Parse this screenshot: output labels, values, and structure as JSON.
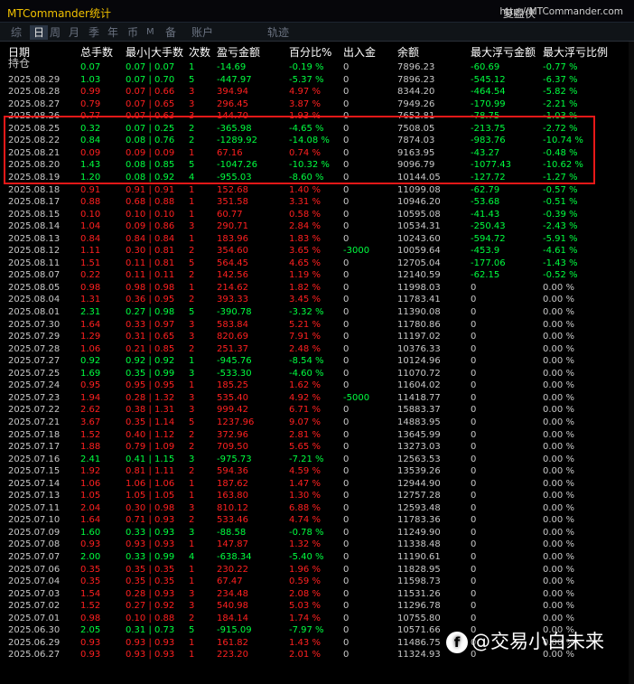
{
  "titlebar": {
    "title": "MTCommander统计",
    "replay": "复盘侠",
    "url": "http://MTCommander.com"
  },
  "tabs": [
    {
      "label": "综",
      "active": false
    },
    {
      "label": "日",
      "active": true
    },
    {
      "label": "周",
      "active": false
    },
    {
      "label": "月",
      "active": false
    },
    {
      "label": "季",
      "active": false
    },
    {
      "label": "年",
      "active": false
    },
    {
      "label": "币",
      "active": false
    },
    {
      "label": "M",
      "active": false
    },
    {
      "label": "备",
      "active": false
    },
    {
      "label": "账户",
      "active": false
    },
    {
      "label": "轨迹",
      "active": false
    }
  ],
  "table": {
    "headers": [
      "日期",
      "总手数",
      "最小|大手数",
      "次数",
      "盈亏金额",
      "百分比%",
      "出入金",
      "余额",
      "最大浮亏金额",
      "最大浮亏比例"
    ],
    "holding_label": "持仓",
    "holding": [
      "",
      "0.07",
      "0.07 | 0.07",
      "1",
      "-14.69",
      "-0.19 %",
      "0",
      "7896.23",
      "-60.69",
      "-0.77 %"
    ],
    "rows": [
      [
        "2025.08.29",
        "1.03",
        "0.07 | 0.70",
        "5",
        "-447.97",
        "-5.37 %",
        "0",
        "7896.23",
        "-545.12",
        "-6.37 %"
      ],
      [
        "2025.08.28",
        "0.99",
        "0.07 | 0.66",
        "3",
        "394.94",
        "4.97 %",
        "0",
        "8344.20",
        "-464.54",
        "-5.82 %"
      ],
      [
        "2025.08.27",
        "0.79",
        "0.07 | 0.65",
        "3",
        "296.45",
        "3.87 %",
        "0",
        "7949.26",
        "-170.99",
        "-2.21 %"
      ],
      [
        "2025.08.26",
        "0.77",
        "0.07 | 0.63",
        "3",
        "144.70",
        "1.93 %",
        "0",
        "7652.81",
        "-78.75",
        "-1.03 %"
      ],
      [
        "2025.08.25",
        "0.32",
        "0.07 | 0.25",
        "2",
        "-365.98",
        "-4.65 %",
        "0",
        "7508.05",
        "-213.75",
        "-2.72 %"
      ],
      [
        "2025.08.22",
        "0.84",
        "0.08 | 0.76",
        "2",
        "-1289.92",
        "-14.08 %",
        "0",
        "7874.03",
        "-983.76",
        "-10.74 %"
      ],
      [
        "2025.08.21",
        "0.09",
        "0.09 | 0.09",
        "1",
        "67.16",
        "0.74 %",
        "0",
        "9163.95",
        "-43.27",
        "-0.48 %"
      ],
      [
        "2025.08.20",
        "1.43",
        "0.08 | 0.85",
        "5",
        "-1047.26",
        "-10.32 %",
        "0",
        "9096.79",
        "-1077.43",
        "-10.62 %"
      ],
      [
        "2025.08.19",
        "1.20",
        "0.08 | 0.92",
        "4",
        "-955.03",
        "-8.60 %",
        "0",
        "10144.05",
        "-127.72",
        "-1.27 %"
      ],
      [
        "2025.08.18",
        "0.91",
        "0.91 | 0.91",
        "1",
        "152.68",
        "1.40 %",
        "0",
        "11099.08",
        "-62.79",
        "-0.57 %"
      ],
      [
        "2025.08.17",
        "0.88",
        "0.68 | 0.88",
        "1",
        "351.58",
        "3.31 %",
        "0",
        "10946.20",
        "-53.68",
        "-0.51 %"
      ],
      [
        "2025.08.15",
        "0.10",
        "0.10 | 0.10",
        "1",
        "60.77",
        "0.58 %",
        "0",
        "10595.08",
        "-41.43",
        "-0.39 %"
      ],
      [
        "2025.08.14",
        "1.04",
        "0.09 | 0.86",
        "3",
        "290.71",
        "2.84 %",
        "0",
        "10534.31",
        "-250.43",
        "-2.43 %"
      ],
      [
        "2025.08.13",
        "0.84",
        "0.84 | 0.84",
        "1",
        "183.96",
        "1.83 %",
        "0",
        "10243.60",
        "-594.72",
        "-5.91 %"
      ],
      [
        "2025.08.12",
        "1.11",
        "0.30 | 0.81",
        "2",
        "354.60",
        "3.65 %",
        "-3000",
        "10059.64",
        "-453.9",
        "-4.61 %"
      ],
      [
        "2025.08.11",
        "1.51",
        "0.11 | 0.81",
        "5",
        "564.45",
        "4.65 %",
        "0",
        "12705.04",
        "-177.06",
        "-1.43 %"
      ],
      [
        "2025.08.07",
        "0.22",
        "0.11 | 0.11",
        "2",
        "142.56",
        "1.19 %",
        "0",
        "12140.59",
        "-62.15",
        "-0.52 %"
      ],
      [
        "2025.08.05",
        "0.98",
        "0.98 | 0.98",
        "1",
        "214.62",
        "1.82 %",
        "0",
        "11998.03",
        "0",
        "0.00 %"
      ],
      [
        "2025.08.04",
        "1.31",
        "0.36 | 0.95",
        "2",
        "393.33",
        "3.45 %",
        "0",
        "11783.41",
        "0",
        "0.00 %"
      ],
      [
        "2025.08.01",
        "2.31",
        "0.27 | 0.98",
        "5",
        "-390.78",
        "-3.32 %",
        "0",
        "11390.08",
        "0",
        "0.00 %"
      ],
      [
        "2025.07.30",
        "1.64",
        "0.33 | 0.97",
        "3",
        "583.84",
        "5.21 %",
        "0",
        "11780.86",
        "0",
        "0.00 %"
      ],
      [
        "2025.07.29",
        "1.29",
        "0.31 | 0.65",
        "3",
        "820.69",
        "7.91 %",
        "0",
        "11197.02",
        "0",
        "0.00 %"
      ],
      [
        "2025.07.28",
        "1.06",
        "0.21 | 0.85",
        "2",
        "251.37",
        "2.48 %",
        "0",
        "10376.33",
        "0",
        "0.00 %"
      ],
      [
        "2025.07.27",
        "0.92",
        "0.92 | 0.92",
        "1",
        "-945.76",
        "-8.54 %",
        "0",
        "10124.96",
        "0",
        "0.00 %"
      ],
      [
        "2025.07.25",
        "1.69",
        "0.35 | 0.99",
        "3",
        "-533.30",
        "-4.60 %",
        "0",
        "11070.72",
        "0",
        "0.00 %"
      ],
      [
        "2025.07.24",
        "0.95",
        "0.95 | 0.95",
        "1",
        "185.25",
        "1.62 %",
        "0",
        "11604.02",
        "0",
        "0.00 %"
      ],
      [
        "2025.07.23",
        "1.94",
        "0.28 | 1.32",
        "3",
        "535.40",
        "4.92 %",
        "-5000",
        "11418.77",
        "0",
        "0.00 %"
      ],
      [
        "2025.07.22",
        "2.62",
        "0.38 | 1.31",
        "3",
        "999.42",
        "6.71 %",
        "0",
        "15883.37",
        "0",
        "0.00 %"
      ],
      [
        "2025.07.21",
        "3.67",
        "0.35 | 1.14",
        "5",
        "1237.96",
        "9.07 %",
        "0",
        "14883.95",
        "0",
        "0.00 %"
      ],
      [
        "2025.07.18",
        "1.52",
        "0.40 | 1.12",
        "2",
        "372.96",
        "2.81 %",
        "0",
        "13645.99",
        "0",
        "0.00 %"
      ],
      [
        "2025.07.17",
        "1.88",
        "0.79 | 1.09",
        "2",
        "709.50",
        "5.65 %",
        "0",
        "13273.03",
        "0",
        "0.00 %"
      ],
      [
        "2025.07.16",
        "2.41",
        "0.41 | 1.15",
        "3",
        "-975.73",
        "-7.21 %",
        "0",
        "12563.53",
        "0",
        "0.00 %"
      ],
      [
        "2025.07.15",
        "1.92",
        "0.81 | 1.11",
        "2",
        "594.36",
        "4.59 %",
        "0",
        "13539.26",
        "0",
        "0.00 %"
      ],
      [
        "2025.07.14",
        "1.06",
        "1.06 | 1.06",
        "1",
        "187.62",
        "1.47 %",
        "0",
        "12944.90",
        "0",
        "0.00 %"
      ],
      [
        "2025.07.13",
        "1.05",
        "1.05 | 1.05",
        "1",
        "163.80",
        "1.30 %",
        "0",
        "12757.28",
        "0",
        "0.00 %"
      ],
      [
        "2025.07.11",
        "2.04",
        "0.30 | 0.98",
        "3",
        "810.12",
        "6.88 %",
        "0",
        "12593.48",
        "0",
        "0.00 %"
      ],
      [
        "2025.07.10",
        "1.64",
        "0.71 | 0.93",
        "2",
        "533.46",
        "4.74 %",
        "0",
        "11783.36",
        "0",
        "0.00 %"
      ],
      [
        "2025.07.09",
        "1.60",
        "0.33 | 0.93",
        "3",
        "-88.58",
        "-0.78 %",
        "0",
        "11249.90",
        "0",
        "0.00 %"
      ],
      [
        "2025.07.08",
        "0.93",
        "0.93 | 0.93",
        "1",
        "147.87",
        "1.32 %",
        "0",
        "11338.48",
        "0",
        "0.00 %"
      ],
      [
        "2025.07.07",
        "2.00",
        "0.33 | 0.99",
        "4",
        "-638.34",
        "-5.40 %",
        "0",
        "11190.61",
        "0",
        "0.00 %"
      ],
      [
        "2025.07.06",
        "0.35",
        "0.35 | 0.35",
        "1",
        "230.22",
        "1.96 %",
        "0",
        "11828.95",
        "0",
        "0.00 %"
      ],
      [
        "2025.07.04",
        "0.35",
        "0.35 | 0.35",
        "1",
        "67.47",
        "0.59 %",
        "0",
        "11598.73",
        "0",
        "0.00 %"
      ],
      [
        "2025.07.03",
        "1.54",
        "0.28 | 0.93",
        "3",
        "234.48",
        "2.08 %",
        "0",
        "11531.26",
        "0",
        "0.00 %"
      ],
      [
        "2025.07.02",
        "1.52",
        "0.27 | 0.92",
        "3",
        "540.98",
        "5.03 %",
        "0",
        "11296.78",
        "0",
        "0.00 %"
      ],
      [
        "2025.07.01",
        "0.98",
        "0.10 | 0.88",
        "2",
        "184.14",
        "1.74 %",
        "0",
        "10755.80",
        "0",
        "0.00 %"
      ],
      [
        "2025.06.30",
        "2.05",
        "0.31 | 0.73",
        "5",
        "-915.09",
        "-7.97 %",
        "0",
        "10571.66",
        "0",
        "0.00 %"
      ],
      [
        "2025.06.29",
        "0.93",
        "0.93 | 0.93",
        "1",
        "161.82",
        "1.43 %",
        "0",
        "11486.75",
        "0",
        "0.00 %"
      ],
      [
        "2025.06.27",
        "0.93",
        "0.93 | 0.93",
        "1",
        "223.20",
        "2.01 %",
        "0",
        "11324.93",
        "0",
        "0.00 %"
      ]
    ]
  },
  "watermark": {
    "logo": "f",
    "text": "@交易小白未来"
  }
}
